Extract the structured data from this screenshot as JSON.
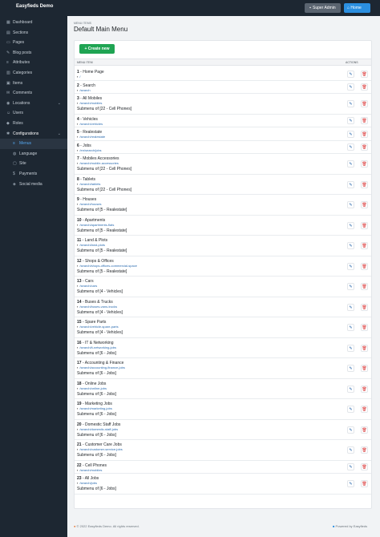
{
  "topbar": {
    "brand": "Easyfieds Demo",
    "super_admin": "Super Admin",
    "home": "Home"
  },
  "sidebar": {
    "items": [
      {
        "label": "Dashboard",
        "icon": "dashboard-icon"
      },
      {
        "label": "Sections",
        "icon": "sections-icon"
      },
      {
        "label": "Pages",
        "icon": "pages-icon"
      },
      {
        "label": "Blog posts",
        "icon": "blog-icon"
      },
      {
        "label": "Attributes",
        "icon": "attributes-icon"
      },
      {
        "label": "Categories",
        "icon": "categories-icon"
      },
      {
        "label": "Items",
        "icon": "items-icon"
      },
      {
        "label": "Comments",
        "icon": "comments-icon"
      },
      {
        "label": "Locations",
        "icon": "locations-icon"
      },
      {
        "label": "Users",
        "icon": "users-icon"
      },
      {
        "label": "Roles",
        "icon": "roles-icon"
      },
      {
        "label": "Configurations",
        "icon": "configurations-icon"
      }
    ],
    "sub_items": [
      {
        "label": "Menus",
        "icon": "menus-icon"
      },
      {
        "label": "Language",
        "icon": "language-icon"
      },
      {
        "label": "Site",
        "icon": "site-icon"
      },
      {
        "label": "Payments",
        "icon": "payments-icon"
      },
      {
        "label": "Social media",
        "icon": "social-media-icon"
      }
    ]
  },
  "page": {
    "breadcrumb": "MENU ITEMS",
    "title": "Default Main Menu",
    "create_label": "+ Create new",
    "col_menu_item": "MENU ITEM",
    "col_actions": "ACTIONS"
  },
  "rows": [
    {
      "num": "1",
      "name": "Home Page",
      "link": "/",
      "sub": ""
    },
    {
      "num": "2",
      "name": "Search",
      "link": "/search",
      "sub": ""
    },
    {
      "num": "3",
      "name": "All Mobiles",
      "link": "/search/mobiles",
      "sub": "Submenu of [22 - Cell Phones]"
    },
    {
      "num": "4",
      "name": "Vehicles",
      "link": "/search/vehicles",
      "sub": ""
    },
    {
      "num": "5",
      "name": "Realestate",
      "link": "/search/realestate",
      "sub": ""
    },
    {
      "num": "6",
      "name": "Jobs",
      "link": "/en/search/jobs",
      "sub": ""
    },
    {
      "num": "7",
      "name": "Mobiles Accessories",
      "link": "/search/mobile-accessories",
      "sub": "Submenu of [22 - Cell Phones]"
    },
    {
      "num": "8",
      "name": "Tablets",
      "link": "/search/tablets",
      "sub": "Submenu of [22 - Cell Phones]"
    },
    {
      "num": "9",
      "name": "Houses",
      "link": "/search/houses",
      "sub": "Submenu of [5 - Realestate]"
    },
    {
      "num": "10",
      "name": "Apartments",
      "link": "/search/apartments-flats",
      "sub": "Submenu of [5 - Realestate]"
    },
    {
      "num": "11",
      "name": "Land & Plots",
      "link": "/search/land-plots",
      "sub": "Submenu of [5 - Realestate]"
    },
    {
      "num": "12",
      "name": "Shops & Offices",
      "link": "/search/shops-offices-commercial-space",
      "sub": "Submenu of [5 - Realestate]"
    },
    {
      "num": "13",
      "name": "Cars",
      "link": "/search/cars",
      "sub": "Submenu of [4 - Vehicles]"
    },
    {
      "num": "14",
      "name": "Buses & Trucks",
      "link": "/search/buses-vans-trucks",
      "sub": "Submenu of [4 - Vehicles]"
    },
    {
      "num": "15",
      "name": "Spare Parts",
      "link": "/search/vehicle-spare-parts",
      "sub": "Submenu of [4 - Vehicles]"
    },
    {
      "num": "16",
      "name": "IT & Networking",
      "link": "/search/it-networking-jobs",
      "sub": "Submenu of [6 - Jobs]"
    },
    {
      "num": "17",
      "name": "Accounting & Finance",
      "link": "/search/accounting-finance-jobs",
      "sub": "Submenu of [6 - Jobs]"
    },
    {
      "num": "18",
      "name": "Online Jobs",
      "link": "/search/online-jobs",
      "sub": "Submenu of [6 - Jobs]"
    },
    {
      "num": "19",
      "name": "Marketing Jobs",
      "link": "/search/marketing-jobs",
      "sub": "Submenu of [6 - Jobs]"
    },
    {
      "num": "20",
      "name": "Domestic Staff Jobs",
      "link": "/search/domestic-staff-jobs",
      "sub": "Submenu of [6 - Jobs]"
    },
    {
      "num": "21",
      "name": "Customer Care Jobs",
      "link": "/search/customer-service-jobs",
      "sub": "Submenu of [6 - Jobs]"
    },
    {
      "num": "22",
      "name": "Cell Phones",
      "link": "/search/mobiles",
      "sub": ""
    },
    {
      "num": "23",
      "name": "All Jobs",
      "link": "/search/jobs",
      "sub": "Submenu of [6 - Jobs]"
    }
  ],
  "footer": {
    "copyright": "© 2022 Easyfieds Demo. All rights reserved.",
    "powered": "Powered by Easyfieds"
  }
}
